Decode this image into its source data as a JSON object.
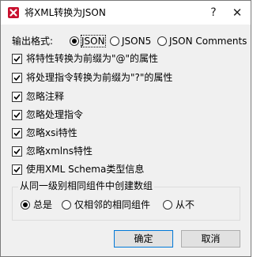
{
  "window": {
    "title": "将XML转换为JSON",
    "help_glyph": "?",
    "close_glyph": "✕"
  },
  "output_format": {
    "label": "输出格式:",
    "options": [
      "JSON",
      "JSON5",
      "JSON Comments"
    ],
    "selected": "JSON"
  },
  "options": [
    {
      "label": "将特性转换为前缀为\"@\"的属性",
      "checked": true
    },
    {
      "label": "将处理指令转换为前缀为\"?\"的属性",
      "checked": true
    },
    {
      "label": "忽略注释",
      "checked": true
    },
    {
      "label": "忽略处理指令",
      "checked": true
    },
    {
      "label": "忽略xsi特性",
      "checked": true
    },
    {
      "label": "忽略xmlns特性",
      "checked": true
    },
    {
      "label": "使用XML Schema类型信息",
      "checked": true
    }
  ],
  "array_group": {
    "title": "从同一级别相同组件中创建数组",
    "options": [
      "总是",
      "仅相邻的相同组件",
      "从不"
    ],
    "selected": "总是"
  },
  "buttons": {
    "ok": "确定",
    "cancel": "取消"
  }
}
